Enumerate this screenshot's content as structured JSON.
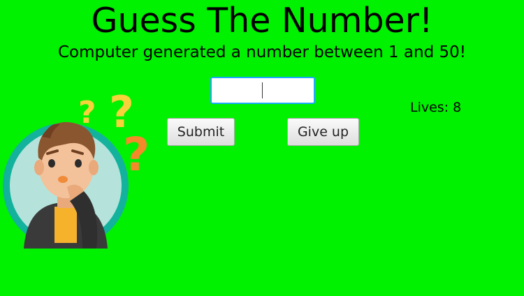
{
  "app": {
    "title": "Guess The Number!",
    "subtitle": "Computer generated a number between 1 and 50!",
    "background_color": "#00f200"
  },
  "guess_input": {
    "value": "",
    "placeholder": ""
  },
  "buttons": {
    "submit_label": "Submit",
    "give_up_label": "Give up"
  },
  "status": {
    "lives_label": "Lives: 8"
  },
  "illustration": {
    "icon": "thinking-man-question-marks-icon",
    "colors": {
      "ring": "#13b29d",
      "ring_fill": "#b5e3dc",
      "question_yellow": "#f7d23a",
      "question_orange": "#f4892a"
    }
  }
}
